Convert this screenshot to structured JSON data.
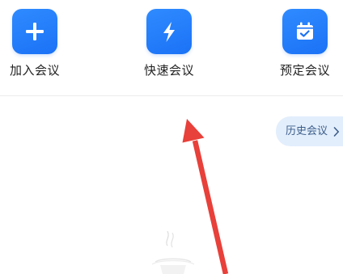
{
  "quick_actions": [
    {
      "label": "加入会议",
      "icon": "plus-icon"
    },
    {
      "label": "快速会议",
      "icon": "lightning-icon"
    },
    {
      "label": "预定会议",
      "icon": "calendar-check-icon"
    }
  ],
  "history": {
    "label": "历史会议",
    "icon": "chevron-right-icon"
  },
  "colors": {
    "accent_blue": "#1b72f6",
    "pill_background": "#e2eefc",
    "pill_text": "#3c5d8a",
    "annotation_arrow": "#e8403a",
    "label_text": "#222222"
  }
}
